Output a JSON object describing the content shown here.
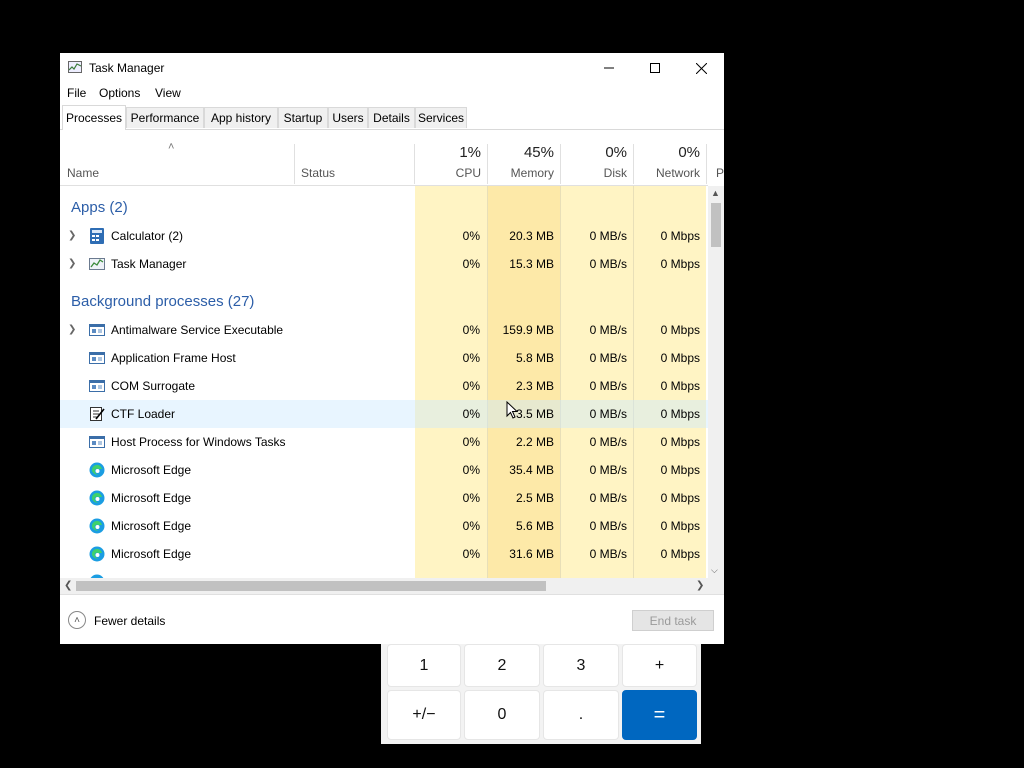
{
  "calculator": {
    "keys": [
      {
        "label": "1"
      },
      {
        "label": "2"
      },
      {
        "label": "3"
      },
      {
        "label": "+"
      },
      {
        "label": "+/−"
      },
      {
        "label": "0"
      },
      {
        "label": "."
      },
      {
        "label": "="
      }
    ]
  },
  "window": {
    "title": "Task Manager",
    "menu": [
      "File",
      "Options",
      "View"
    ],
    "tabs": [
      "Processes",
      "Performance",
      "App history",
      "Startup",
      "Users",
      "Details",
      "Services"
    ],
    "active_tab": "Processes"
  },
  "header": {
    "name": "Name",
    "status": "Status",
    "cpu_pct": "1%",
    "cpu": "CPU",
    "memory_pct": "45%",
    "memory": "Memory",
    "disk_pct": "0%",
    "disk": "Disk",
    "network_pct": "0%",
    "network": "Network",
    "power_partial": "P"
  },
  "groups": {
    "apps": "Apps (2)",
    "background": "Background processes (27)"
  },
  "rows": [
    {
      "name": "Calculator (2)",
      "cpu": "0%",
      "memory": "20.3 MB",
      "disk": "0 MB/s",
      "network": "0 Mbps"
    },
    {
      "name": "Task Manager",
      "cpu": "0%",
      "memory": "15.3 MB",
      "disk": "0 MB/s",
      "network": "0 Mbps"
    },
    {
      "name": "Antimalware Service Executable",
      "cpu": "0%",
      "memory": "159.9 MB",
      "disk": "0 MB/s",
      "network": "0 Mbps"
    },
    {
      "name": "Application Frame Host",
      "cpu": "0%",
      "memory": "5.8 MB",
      "disk": "0 MB/s",
      "network": "0 Mbps"
    },
    {
      "name": "COM Surrogate",
      "cpu": "0%",
      "memory": "2.3 MB",
      "disk": "0 MB/s",
      "network": "0 Mbps"
    },
    {
      "name": "CTF Loader",
      "cpu": "0%",
      "memory": "3.5 MB",
      "disk": "0 MB/s",
      "network": "0 Mbps"
    },
    {
      "name": "Host Process for Windows Tasks",
      "cpu": "0%",
      "memory": "2.2 MB",
      "disk": "0 MB/s",
      "network": "0 Mbps"
    },
    {
      "name": "Microsoft Edge",
      "cpu": "0%",
      "memory": "35.4 MB",
      "disk": "0 MB/s",
      "network": "0 Mbps"
    },
    {
      "name": "Microsoft Edge",
      "cpu": "0%",
      "memory": "2.5 MB",
      "disk": "0 MB/s",
      "network": "0 Mbps"
    },
    {
      "name": "Microsoft Edge",
      "cpu": "0%",
      "memory": "5.6 MB",
      "disk": "0 MB/s",
      "network": "0 Mbps"
    },
    {
      "name": "Microsoft Edge",
      "cpu": "0%",
      "memory": "31.6 MB",
      "disk": "0 MB/s",
      "network": "0 Mbps"
    }
  ],
  "footer": {
    "fewer_details": "Fewer details",
    "end_task": "End task"
  },
  "colors": {
    "heat_light": "#fff4c4",
    "heat_medium": "#fde9a8",
    "group_text": "#2c5ea8",
    "accent": "#0067c0"
  }
}
